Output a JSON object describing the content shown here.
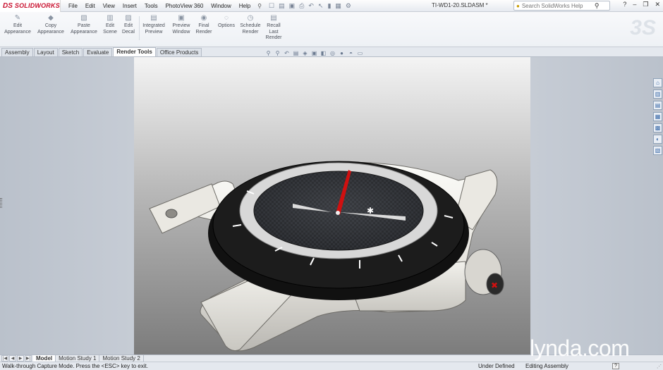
{
  "app": {
    "logo_text": "SOLIDWORKS",
    "logo_mark": "DS",
    "document_title": "TI-WD1-20.SLDASM *"
  },
  "menu": [
    "File",
    "Edit",
    "View",
    "Insert",
    "Tools",
    "PhotoView 360",
    "Window",
    "Help"
  ],
  "help_search": {
    "placeholder": "Search SolidWorks Help"
  },
  "ribbon": [
    {
      "label": "Edit\nAppearance",
      "icon": "edit-appearance-icon"
    },
    {
      "label": "Copy\nAppearance",
      "icon": "copy-appearance-icon"
    },
    {
      "label": "Paste\nAppearance",
      "icon": "paste-appearance-icon"
    },
    {
      "label": "Edit\nScene",
      "icon": "edit-scene-icon"
    },
    {
      "label": "Edit\nDecal",
      "icon": "edit-decal-icon"
    },
    {
      "label": "Integrated\nPreview",
      "icon": "integrated-preview-icon"
    },
    {
      "label": "Preview\nWindow",
      "icon": "preview-window-icon"
    },
    {
      "label": "Final\nRender",
      "icon": "final-render-icon"
    },
    {
      "label": "Options",
      "icon": "options-icon"
    },
    {
      "label": "Schedule\nRender",
      "icon": "schedule-render-icon"
    },
    {
      "label": "Recall\nLast\nRender",
      "icon": "recall-render-icon"
    }
  ],
  "tabs": [
    "Assembly",
    "Layout",
    "Sketch",
    "Evaluate",
    "Render Tools",
    "Office Products"
  ],
  "active_tab": "Render Tools",
  "bottom_tabs": [
    "Model",
    "Motion Study 1",
    "Motion Study 2"
  ],
  "active_bottom_tab": "Model",
  "status": {
    "message": "Walk-through Capture Mode.  Press the <ESC> key to exit.",
    "definition": "Under Defined",
    "mode": "Editing Assembly",
    "help": "?"
  },
  "watermark": "lynda.com",
  "colors": {
    "brand_red": "#c8102e",
    "bezel": "#1a1a1a",
    "case": "#e8e6e0",
    "second_hand": "#d01010"
  }
}
